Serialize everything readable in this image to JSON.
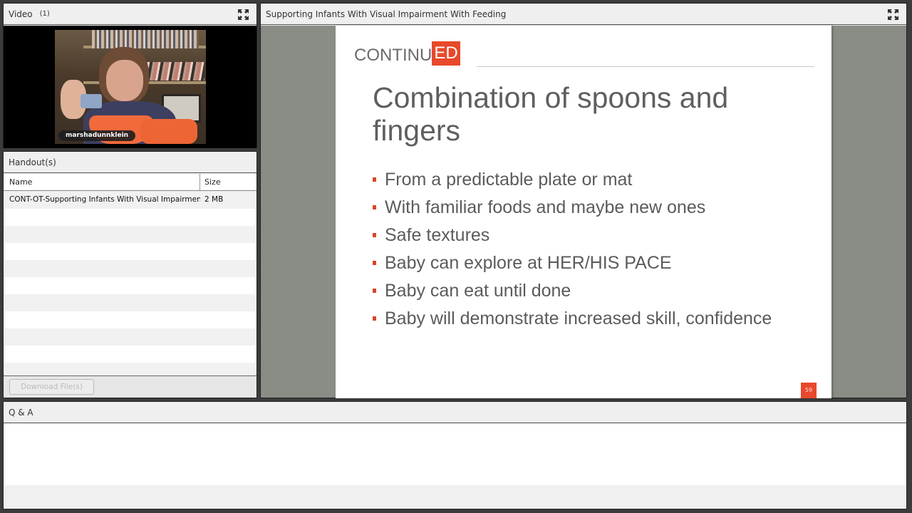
{
  "video_pod": {
    "title": "Video",
    "count": "(1)",
    "presenter_name": "marshadunnklein"
  },
  "handout_pod": {
    "title": "Handout(s)",
    "columns": {
      "name": "Name",
      "size": "Size"
    },
    "rows": [
      {
        "name": "CONT-OT-Supporting Infants With Visual Impairment With Feeding",
        "size": "2 MB"
      }
    ],
    "download_label": "Download File(s)"
  },
  "share_pod": {
    "title": "Supporting Infants With Visual Impairment With Feeding",
    "slide": {
      "logo_plain": "CONTINU",
      "logo_boxed": "ED",
      "title": "Combination of spoons and fingers",
      "bullets": [
        "From a predictable plate or mat",
        "With familiar foods and maybe new ones",
        "Safe textures",
        "Baby can explore at HER/HIS PACE",
        "Baby can eat until done",
        "Baby will demonstrate increased skill, confidence"
      ],
      "page_number": "59",
      "accent_color": "#e8482b"
    }
  },
  "qa_pod": {
    "title": "Q & A"
  }
}
